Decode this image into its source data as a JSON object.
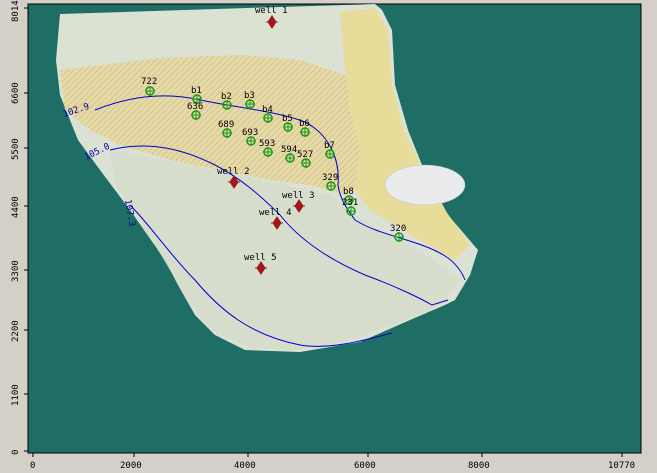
{
  "axes": {
    "x_ticks": [
      "0",
      "2000",
      "4000",
      "6000",
      "8000",
      "10770"
    ],
    "y_ticks": [
      "8014",
      "6600",
      "5500",
      "4400",
      "3300",
      "2200",
      "1100",
      "0"
    ]
  },
  "colors": {
    "frame_background": "#d4d0c8",
    "inactive_cells": "#1e6e66",
    "active_cells": "#dfe5d8",
    "contour_line": "#0000cc",
    "pumping_well": "#a01818",
    "observation_point": "#1c9a1c"
  },
  "contours": [
    {
      "label": "102.9"
    },
    {
      "label": "105.0"
    },
    {
      "label": "107.3"
    }
  ],
  "pumping_wells": [
    {
      "label": "well 1",
      "icon": "pumping-well-icon"
    },
    {
      "label": "well 2",
      "icon": "pumping-well-icon"
    },
    {
      "label": "well 3",
      "icon": "pumping-well-icon"
    },
    {
      "label": "well 4",
      "icon": "pumping-well-icon"
    },
    {
      "label": "well 5",
      "icon": "pumping-well-icon"
    }
  ],
  "observation_points": [
    {
      "label": "722"
    },
    {
      "label": "b1"
    },
    {
      "label": "b2"
    },
    {
      "label": "b3"
    },
    {
      "label": "636"
    },
    {
      "label": "b4"
    },
    {
      "label": "b5"
    },
    {
      "label": "b6"
    },
    {
      "label": "689"
    },
    {
      "label": "693"
    },
    {
      "label": "593"
    },
    {
      "label": "594"
    },
    {
      "label": "527"
    },
    {
      "label": "b7"
    },
    {
      "label": "329"
    },
    {
      "label": "b8"
    },
    {
      "label": "231"
    },
    {
      "label": "320"
    }
  ]
}
